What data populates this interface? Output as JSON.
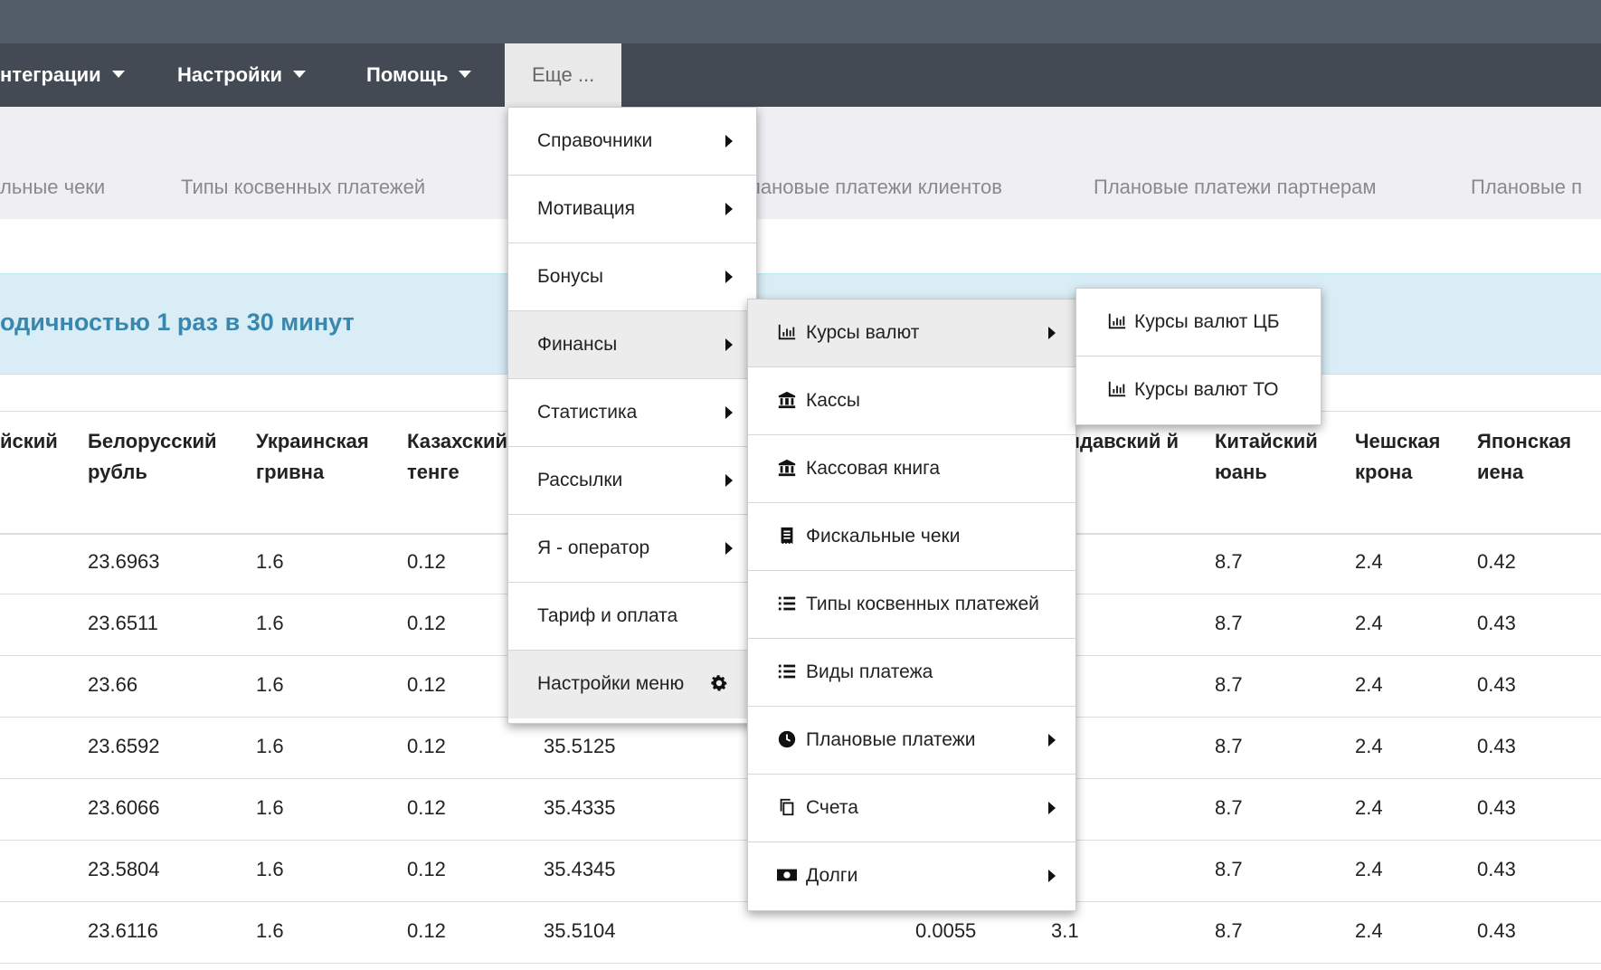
{
  "navbar": {
    "items": [
      {
        "label": "нтеграции"
      },
      {
        "label": "Настройки"
      },
      {
        "label": "Помощь"
      }
    ],
    "more_label": "Еще ..."
  },
  "subnav": {
    "items": [
      {
        "label": "льные чеки"
      },
      {
        "label": "Типы косвенных платежей"
      },
      {
        "label": "лановые платежи клиентов"
      },
      {
        "label": "Плановые платежи партнерам"
      },
      {
        "label": "Плановые п"
      }
    ]
  },
  "alert": {
    "text": "одичностью 1 раз в 30 минут"
  },
  "table": {
    "headers": [
      {
        "label": "йский"
      },
      {
        "label": "Белорусский рубль"
      },
      {
        "label": "Украинская гривна"
      },
      {
        "label": "Казахский тенге"
      },
      {
        "label": "лдавский й"
      },
      {
        "label": "Китайский юань"
      },
      {
        "label": "Чешская крона"
      },
      {
        "label": "Японская иена"
      }
    ],
    "rows": [
      {
        "byn": "23.6963",
        "uah": "1.6",
        "kzt": "0.12",
        "c4": "",
        "c5": "",
        "c6": "",
        "cny": "8.7",
        "czk": "2.4",
        "jpy": "0.42"
      },
      {
        "byn": "23.6511",
        "uah": "1.6",
        "kzt": "0.12",
        "c4": "",
        "c5": "",
        "c6": "",
        "cny": "8.7",
        "czk": "2.4",
        "jpy": "0.43"
      },
      {
        "byn": "23.66",
        "uah": "1.6",
        "kzt": "0.12",
        "c4": "",
        "c5": "",
        "c6": "",
        "cny": "8.7",
        "czk": "2.4",
        "jpy": "0.43"
      },
      {
        "byn": "23.6592",
        "uah": "1.6",
        "kzt": "0.12",
        "c4": "35.5125",
        "c5": "",
        "c6": "",
        "cny": "8.7",
        "czk": "2.4",
        "jpy": "0.43"
      },
      {
        "byn": "23.6066",
        "uah": "1.6",
        "kzt": "0.12",
        "c4": "35.4335",
        "c5": "",
        "c6": "",
        "cny": "8.7",
        "czk": "2.4",
        "jpy": "0.43"
      },
      {
        "byn": "23.5804",
        "uah": "1.6",
        "kzt": "0.12",
        "c4": "35.4345",
        "c5": "",
        "c6": "",
        "cny": "8.7",
        "czk": "2.4",
        "jpy": "0.43"
      },
      {
        "byn": "23.6116",
        "uah": "1.6",
        "kzt": "0.12",
        "c4": "35.5104",
        "c5": "0.0055",
        "c6": "3.1",
        "cny": "8.7",
        "czk": "2.4",
        "jpy": "0.43"
      }
    ]
  },
  "menu_main": {
    "items": [
      {
        "label": "Справочники",
        "icon": "chevron-right-icon"
      },
      {
        "label": "Мотивация",
        "icon": "chevron-right-icon"
      },
      {
        "label": "Бонусы",
        "icon": "chevron-right-icon"
      },
      {
        "label": "Финансы",
        "icon": "chevron-right-icon"
      },
      {
        "label": "Статистика",
        "icon": "chevron-right-icon"
      },
      {
        "label": "Рассылки",
        "icon": "chevron-right-icon"
      },
      {
        "label": "Я - оператор",
        "icon": "chevron-right-icon"
      },
      {
        "label": "Тариф и оплата"
      },
      {
        "label": "Настройки меню",
        "icon": "gear-icon"
      }
    ]
  },
  "menu_finance": {
    "items": [
      {
        "label": "Курсы валют",
        "icon": "bar-chart-icon"
      },
      {
        "label": "Кассы",
        "icon": "bank-icon"
      },
      {
        "label": "Кассовая книга",
        "icon": "bank-icon"
      },
      {
        "label": "Фискальные чеки",
        "icon": "receipt-icon"
      },
      {
        "label": "Типы косвенных платежей",
        "icon": "list-icon"
      },
      {
        "label": "Виды платежа",
        "icon": "list-icon"
      },
      {
        "label": "Плановые платежи",
        "icon": "clock-icon"
      },
      {
        "label": "Счета",
        "icon": "copy-icon"
      },
      {
        "label": "Долги",
        "icon": "money-icon"
      }
    ]
  },
  "menu_rates": {
    "items": [
      {
        "label": "Курсы валют ЦБ",
        "icon": "bar-chart-icon"
      },
      {
        "label": "Курсы валют ТО",
        "icon": "bar-chart-icon"
      }
    ]
  },
  "colors": {
    "navbar": "#434a54",
    "topbar": "#535d68",
    "alert_bg": "#d9edf7",
    "alert_text": "#3a87ad"
  }
}
